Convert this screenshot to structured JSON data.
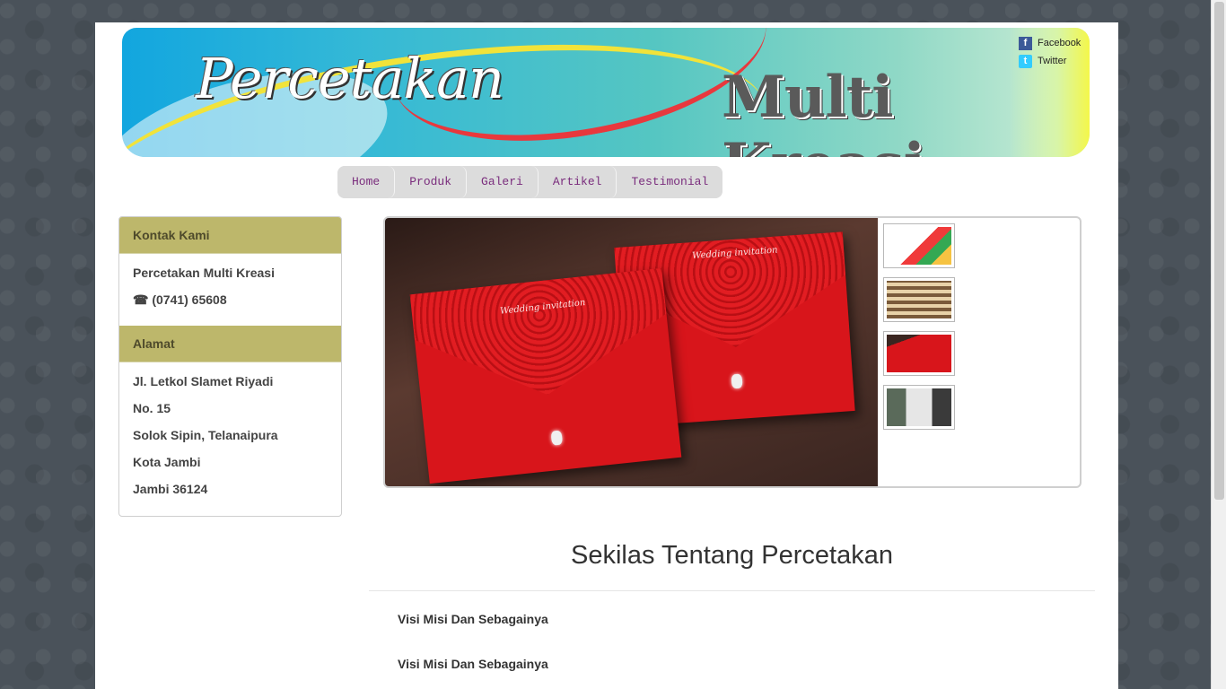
{
  "banner": {
    "brand_left": "Percetakan",
    "brand_right": "Multi Kreasi"
  },
  "social": {
    "facebook": "Facebook",
    "twitter": "Twitter"
  },
  "nav": [
    {
      "label": "Home"
    },
    {
      "label": "Produk"
    },
    {
      "label": "Galeri"
    },
    {
      "label": "Artikel"
    },
    {
      "label": "Testimonial"
    }
  ],
  "sidebar": {
    "contact": {
      "heading": "Kontak Kami",
      "name": "Percetakan Multi Kreasi",
      "phone": "☎ (0741) 65608"
    },
    "address": {
      "heading": "Alamat",
      "lines": [
        "Jl. Letkol Slamet Riyadi",
        "No. 15",
        "Solok Sipin, Telanaipura",
        "Kota Jambi",
        "Jambi 36124"
      ]
    }
  },
  "slider": {
    "card_script": "Wedding invitation"
  },
  "content": {
    "section_title": "Sekilas Tentang Percetakan",
    "posts": [
      "Visi Misi Dan Sebagainya",
      "Visi Misi Dan Sebagainya"
    ]
  },
  "colors": {
    "sidebar_header": "#bdb76b",
    "nav_text": "#7a2d7d",
    "background": "#4a525a"
  }
}
